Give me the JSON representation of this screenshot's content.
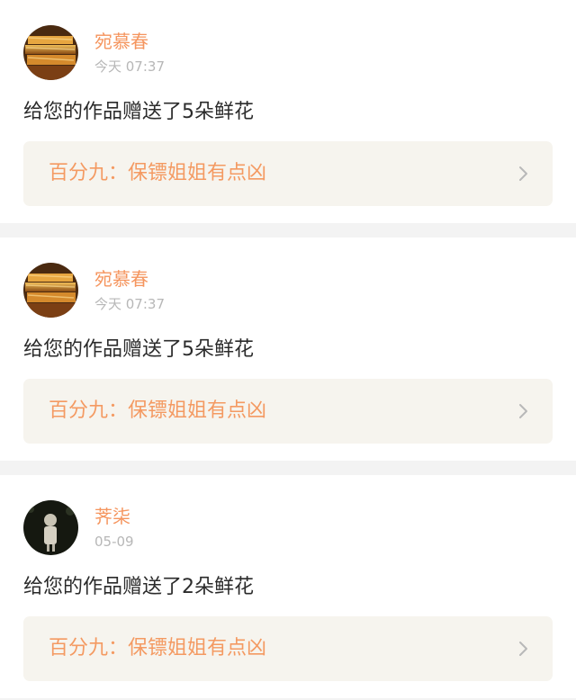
{
  "notifications": [
    {
      "username": "宛慕春",
      "time": "今天 07:37",
      "message": "给您的作品赠送了5朵鲜花",
      "work_title": "百分九：保镖姐姐有点凶",
      "avatar": "gold-bars-avatar"
    },
    {
      "username": "宛慕春",
      "time": "今天 07:37",
      "message": "给您的作品赠送了5朵鲜花",
      "work_title": "百分九：保镖姐姐有点凶",
      "avatar": "gold-bars-avatar"
    },
    {
      "username": "荠柒",
      "time": "05-09",
      "message": "给您的作品赠送了2朵鲜花",
      "work_title": "百分九：保镖姐姐有点凶",
      "avatar": "dark-statue-avatar"
    }
  ],
  "colors": {
    "username": "#f5955e",
    "timestamp": "#b7b7b7",
    "message": "#2b2b2b",
    "work_title": "#f49a62",
    "work_link_bg": "#f6f4ee",
    "divider": "#f3f3f3",
    "top_indicator": "#ea6d9c"
  },
  "icons": {
    "chevron": "chevron-right-icon"
  }
}
